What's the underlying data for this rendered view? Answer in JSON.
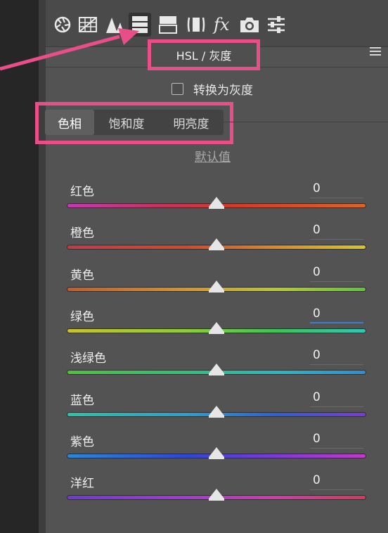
{
  "toolbar": {
    "tools": [
      {
        "name": "basic-aperture-icon"
      },
      {
        "name": "tone-curve-icon"
      },
      {
        "name": "detail-icon"
      },
      {
        "name": "hsl-grayscale-icon",
        "active": true
      },
      {
        "name": "split-toning-icon"
      },
      {
        "name": "lens-corrections-icon"
      },
      {
        "name": "effects-icon",
        "text": "fx"
      },
      {
        "name": "camera-calibration-icon"
      },
      {
        "name": "presets-icon"
      }
    ]
  },
  "panel": {
    "title": "HSL / 灰度",
    "convert_label": "转换为灰度",
    "tabs": [
      "色相",
      "饱和度",
      "明亮度"
    ],
    "selected_tab": 0,
    "default_link": "默认值"
  },
  "sliders": [
    {
      "label": "红色",
      "value": "0"
    },
    {
      "label": "橙色",
      "value": "0"
    },
    {
      "label": "黄色",
      "value": "0"
    },
    {
      "label": "绿色",
      "value": "0"
    },
    {
      "label": "浅绿色",
      "value": "0"
    },
    {
      "label": "蓝色",
      "value": "0"
    },
    {
      "label": "紫色",
      "value": "0"
    },
    {
      "label": "洋红",
      "value": "0"
    }
  ],
  "colors": {
    "highlight": "#ea4e88",
    "focus": "#3a7fd5"
  }
}
